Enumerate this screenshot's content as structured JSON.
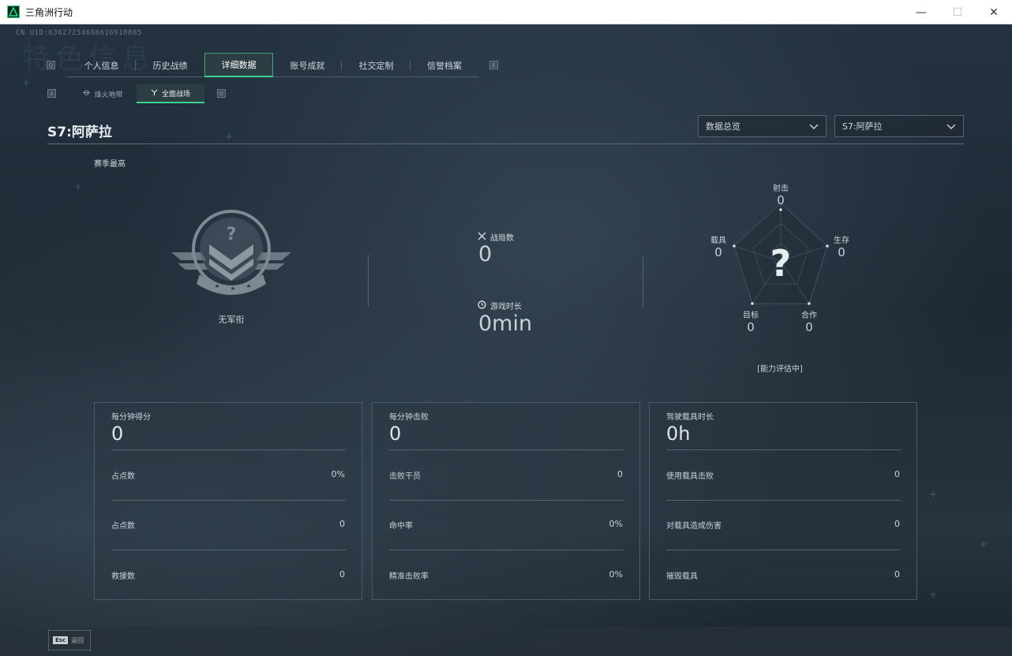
{
  "window": {
    "title": "三角洲行动",
    "minimize": "—",
    "maximize": "☐",
    "close": "✕"
  },
  "uid": "CN UID:6302725468661691008​5",
  "watermark": "特色信息",
  "tabs": {
    "left_key": "Q",
    "right_key": "E",
    "items": [
      {
        "label": "个人信息",
        "active": false
      },
      {
        "label": "历史战绩",
        "active": false
      },
      {
        "label": "详细数据",
        "active": true
      },
      {
        "label": "账号成就",
        "active": false
      },
      {
        "label": "社交定制",
        "active": false
      },
      {
        "label": "信誉档案",
        "active": false
      }
    ]
  },
  "subtabs": {
    "left_key": "A",
    "right_key": "D",
    "items": [
      {
        "label": "烽火地带",
        "icon": "flame-icon",
        "active": false
      },
      {
        "label": "全面战场",
        "icon": "battlefield-icon",
        "active": true
      }
    ]
  },
  "season_title": "S7:阿萨拉",
  "dropdowns": {
    "data_view": "数据总览",
    "season": "S7:阿萨拉"
  },
  "season_best_label": "赛季最高",
  "rank": {
    "name": "无军衔",
    "icon": "unknown-rank-emblem"
  },
  "match_stats": {
    "battles_label": "战局数",
    "battles_value": "0",
    "playtime_label": "游戏时长",
    "playtime_value": "0min"
  },
  "radar": {
    "axes": [
      {
        "key": "shooting",
        "label": "射击",
        "value": "0"
      },
      {
        "key": "survival",
        "label": "生存",
        "value": "0"
      },
      {
        "key": "cooperation",
        "label": "合作",
        "value": "0"
      },
      {
        "key": "objective",
        "label": "目标",
        "value": "0"
      },
      {
        "key": "vehicle",
        "label": "载具",
        "value": "0"
      }
    ],
    "center_symbol": "?",
    "status": "[能力评估中]"
  },
  "cards": [
    {
      "title": "每分钟得分",
      "value": "0",
      "rows": [
        {
          "label": "占点数",
          "value": "0%"
        },
        {
          "label": "占点数",
          "value": "0"
        },
        {
          "label": "救援数",
          "value": "0"
        }
      ]
    },
    {
      "title": "每分钟击败",
      "value": "0",
      "rows": [
        {
          "label": "击败干员",
          "value": "0"
        },
        {
          "label": "命中率",
          "value": "0%"
        },
        {
          "label": "精准击败率",
          "value": "0%"
        }
      ]
    },
    {
      "title": "驾驶载具时长",
      "value": "0h",
      "rows": [
        {
          "label": "使用载具击败",
          "value": "0"
        },
        {
          "label": "对载具造成伤害",
          "value": "0"
        },
        {
          "label": "摧毁载具",
          "value": "0"
        }
      ]
    }
  ],
  "footer": {
    "esc_key": "Esc",
    "esc_label": "返回"
  },
  "colors": {
    "accent": "#3fd08a",
    "background": "#1c2630",
    "text": "#c9d2da"
  }
}
